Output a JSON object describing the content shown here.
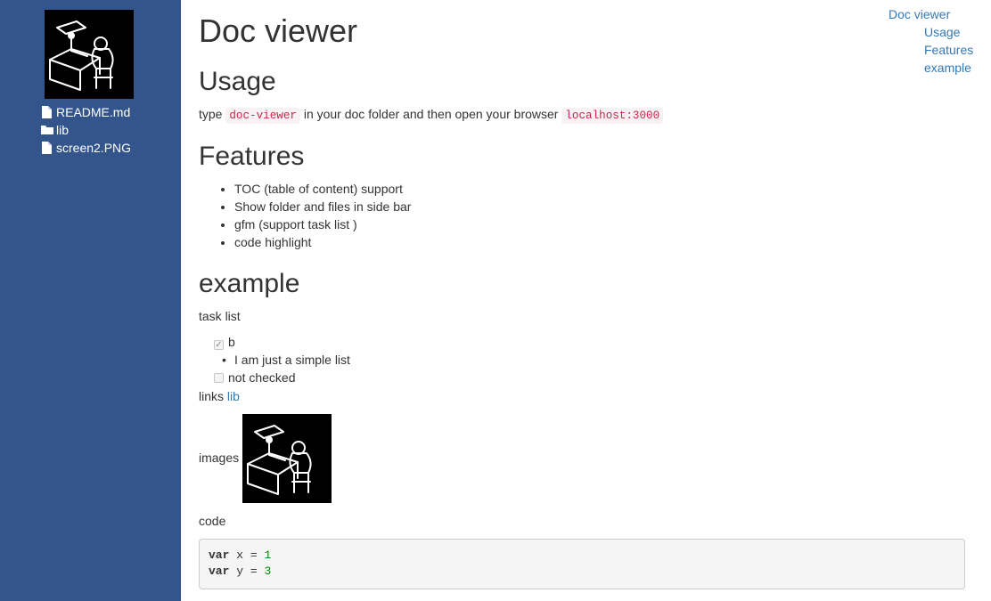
{
  "sidebar": {
    "files": [
      {
        "icon": "file-icon",
        "label": "README.md"
      },
      {
        "icon": "folder-icon",
        "label": "lib"
      },
      {
        "icon": "file-icon",
        "label": "screen2.PNG"
      }
    ]
  },
  "doc": {
    "title": "Doc viewer",
    "usage": {
      "heading": "Usage",
      "text1": "type",
      "code1": "doc-viewer",
      "text2": "in your doc folder and then open your browser",
      "code2": "localhost:3000"
    },
    "features": {
      "heading": "Features",
      "items": [
        "TOC (table of content) support",
        "Show folder and files in side bar",
        "gfm (support task list )",
        "code highlight"
      ]
    },
    "example": {
      "heading": "example",
      "task_list_label": "task list",
      "tasks": [
        {
          "label": "b",
          "checked": true
        },
        {
          "label": "I am just a simple list"
        },
        {
          "label": "not checked",
          "checked": false
        }
      ],
      "links_label": "links",
      "link_text": "lib",
      "images_label": "images",
      "code_label": "code",
      "code_lines": [
        {
          "kw": "var",
          "name": "x",
          "op": "=",
          "num": "1"
        },
        {
          "kw": "var",
          "name": "y",
          "op": "=",
          "num": "3"
        }
      ]
    }
  },
  "toc": {
    "root": "Doc viewer",
    "items": [
      "Usage",
      "Features",
      "example"
    ]
  },
  "colors": {
    "sidebar_bg": "#34558b",
    "link": "#337ab7",
    "code_text": "#c7254e",
    "code_bg": "#f9f2f4",
    "number": "#008800"
  }
}
